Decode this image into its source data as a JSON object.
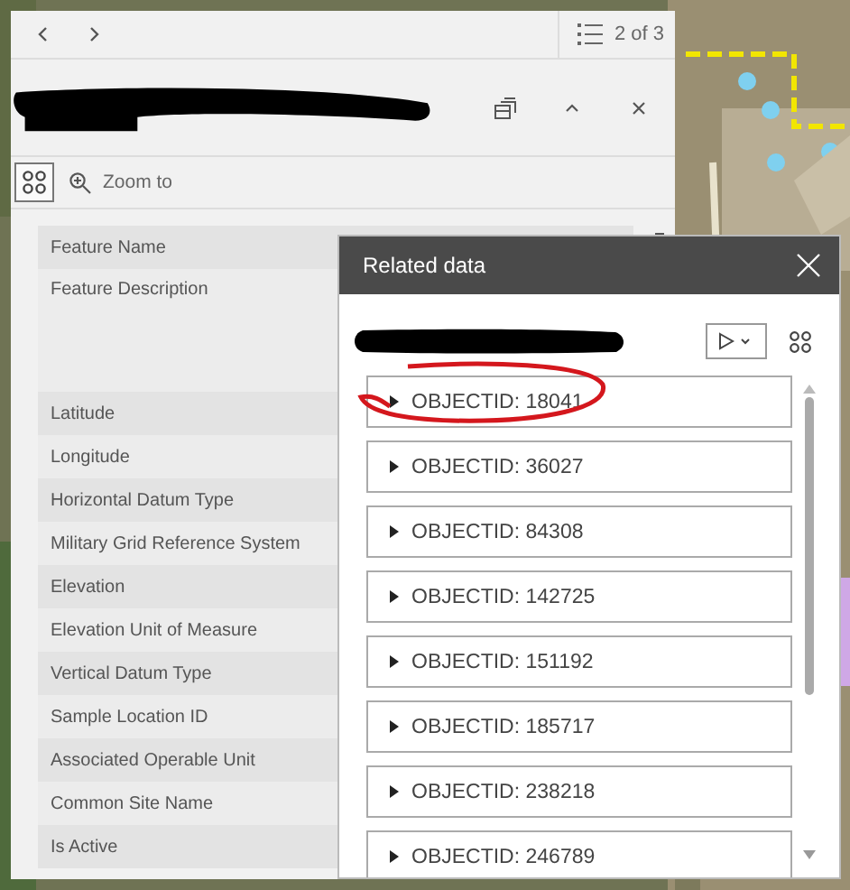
{
  "popup": {
    "page_indicator": "2 of 3",
    "toolbar": {
      "zoom_label": "Zoom to"
    },
    "fields": [
      {
        "label": "Feature Name",
        "tall": false
      },
      {
        "label": "Feature Description",
        "tall": true
      },
      {
        "label": "Latitude",
        "tall": false
      },
      {
        "label": "Longitude",
        "tall": false
      },
      {
        "label": "Horizontal Datum Type",
        "tall": false
      },
      {
        "label": "Military Grid Reference System",
        "tall": false
      },
      {
        "label": "Elevation",
        "tall": false
      },
      {
        "label": "Elevation Unit of Measure",
        "tall": false
      },
      {
        "label": "Vertical Datum Type",
        "tall": false
      },
      {
        "label": "Sample Location ID",
        "tall": false
      },
      {
        "label": "Associated Operable Unit",
        "tall": false
      },
      {
        "label": "Common Site Name",
        "tall": false
      },
      {
        "label": "Is Active",
        "tall": false
      }
    ]
  },
  "related_panel": {
    "title": "Related data",
    "records": [
      {
        "label": "OBJECTID: 18041",
        "expanded": false
      },
      {
        "label": "OBJECTID: 36027",
        "expanded": false
      },
      {
        "label": "OBJECTID: 84308",
        "expanded": false
      },
      {
        "label": "OBJECTID: 142725",
        "expanded": false
      },
      {
        "label": "OBJECTID: 151192",
        "expanded": false
      },
      {
        "label": "OBJECTID: 185717",
        "expanded": false
      },
      {
        "label": "OBJECTID: 238218",
        "expanded": false
      },
      {
        "label": "OBJECTID: 246789",
        "expanded": false
      }
    ]
  }
}
